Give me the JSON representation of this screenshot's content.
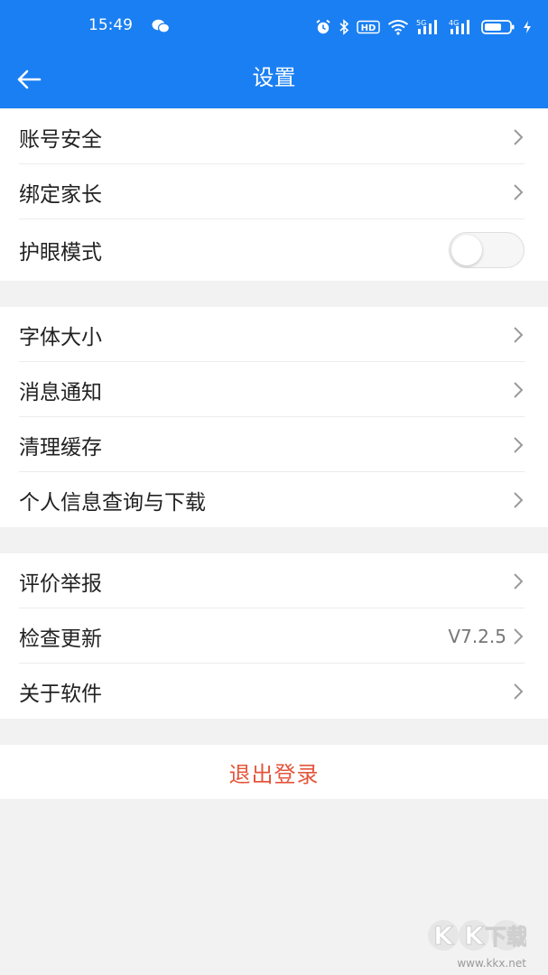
{
  "status_bar": {
    "time": "15:49",
    "right_icons": [
      "alarm-icon",
      "bluetooth-icon",
      "hd-icon",
      "wifi-icon",
      "5g-signal-icon",
      "4g-signal-icon",
      "battery-icon",
      "charging-icon"
    ],
    "hd_label": "HD",
    "net1_label": "5G",
    "net2_label": "4G"
  },
  "header": {
    "title": "设置",
    "background": "#1a7ff2"
  },
  "groups": [
    {
      "items": [
        {
          "label": "账号安全"
        },
        {
          "label": "绑定家长"
        },
        {
          "label": "护眼模式",
          "toggle": false
        }
      ]
    },
    {
      "items": [
        {
          "label": "字体大小"
        },
        {
          "label": "消息通知"
        },
        {
          "label": "清理缓存"
        },
        {
          "label": "个人信息查询与下载"
        }
      ]
    },
    {
      "items": [
        {
          "label": "评价举报"
        },
        {
          "label": "检查更新",
          "value": "V7.2.5"
        },
        {
          "label": "关于软件"
        }
      ]
    }
  ],
  "logout": {
    "label": "退出登录",
    "color": "#e4553b"
  },
  "watermark": {
    "logo_text": "KK下载",
    "url": "www.kkx.net"
  }
}
